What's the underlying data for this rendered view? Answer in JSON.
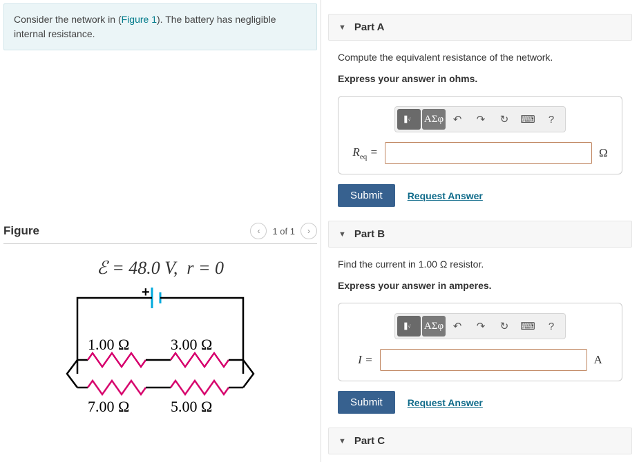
{
  "problem": {
    "prefix": "Consider the network in (",
    "link": "Figure 1",
    "suffix": "). The battery has negligible internal resistance."
  },
  "figure": {
    "title": "Figure",
    "pager": "1 of 1",
    "formula_emf": "ℰ = 48.0 V,",
    "formula_r": "r = 0",
    "plus": "+",
    "r1": "1.00 Ω",
    "r2": "3.00 Ω",
    "r3": "7.00 Ω",
    "r4": "5.00 Ω"
  },
  "partA": {
    "title": "Part A",
    "instruction": "Compute the equivalent resistance of the network.",
    "bold": "Express your answer in ohms.",
    "var_html": "R",
    "var_sub": "eq",
    "equals": " = ",
    "unit": "Ω",
    "submit": "Submit",
    "request": "Request Answer"
  },
  "partB": {
    "title": "Part B",
    "instruction": "Find the current in 1.00 Ω resistor.",
    "bold": "Express your answer in amperes.",
    "var": "I =",
    "unit": "A",
    "submit": "Submit",
    "request": "Request Answer"
  },
  "partC": {
    "title": "Part C"
  },
  "toolbar": {
    "greek": "ΑΣφ",
    "help": "?"
  }
}
